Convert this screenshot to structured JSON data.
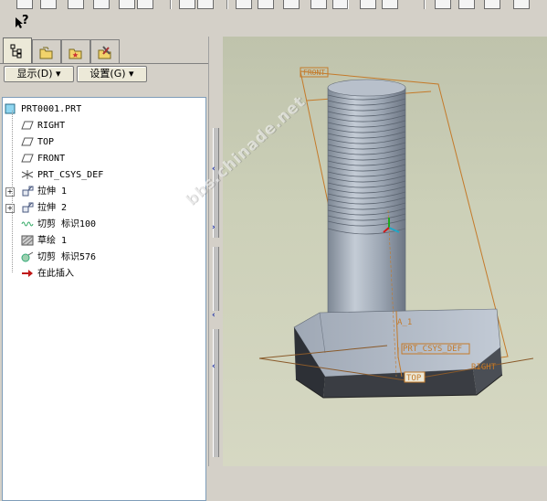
{
  "toolbar": {
    "icons": [
      "new-icon",
      "open-icon",
      "save-icon",
      "print-icon",
      "send-icon",
      "undo-icon",
      "redo-icon",
      "cut-icon",
      "copy-icon",
      "paste-icon",
      "paste-special-icon",
      "regenerate-icon",
      "find-icon",
      "select-icon",
      "saved-view-icon",
      "layers-icon",
      "display-style-icon",
      "datum-icon",
      "spin-icon"
    ],
    "whats_this_glyph": "?"
  },
  "left_panel": {
    "tabs": [
      {
        "name": "model-tree-tab",
        "icon": "model-tree-icon",
        "active": true
      },
      {
        "name": "folder-browser-tab",
        "icon": "folder-icon",
        "active": false
      },
      {
        "name": "favorites-tab",
        "icon": "favorites-icon",
        "active": false
      },
      {
        "name": "web-tab",
        "icon": "tools-icon",
        "active": false
      }
    ],
    "show_label": "显示(D)",
    "settings_label": "设置(G)"
  },
  "model_tree": {
    "items": [
      {
        "label": "PRT0001.PRT",
        "icon": "part-icon",
        "level": 0,
        "expander": ""
      },
      {
        "label": "RIGHT",
        "icon": "datum-plane-icon",
        "level": 1,
        "expander": ""
      },
      {
        "label": "TOP",
        "icon": "datum-plane-icon",
        "level": 1,
        "expander": ""
      },
      {
        "label": "FRONT",
        "icon": "datum-plane-icon",
        "level": 1,
        "expander": ""
      },
      {
        "label": "PRT_CSYS_DEF",
        "icon": "csys-icon",
        "level": 1,
        "expander": ""
      },
      {
        "label": "拉伸 1",
        "icon": "extrude-icon",
        "level": 1,
        "expander": "+"
      },
      {
        "label": "拉伸 2",
        "icon": "extrude-icon",
        "level": 1,
        "expander": "+"
      },
      {
        "label": "切剪 标识100",
        "icon": "cosmetic-thread-icon",
        "level": 1,
        "expander": ""
      },
      {
        "label": "草绘 1",
        "icon": "sketch-icon",
        "level": 1,
        "expander": ""
      },
      {
        "label": "切剪 标识576",
        "icon": "revolve-cut-icon",
        "level": 1,
        "expander": ""
      },
      {
        "label": "在此插入",
        "icon": "insert-here-arrow-icon",
        "level": 1,
        "expander": ""
      }
    ]
  },
  "viewport": {
    "datum_labels": {
      "front": "FRONT",
      "a1": "A_1",
      "csys": "PRT_CSYS_DEF",
      "right": "RIGHT",
      "top": "TOP"
    },
    "watermark": "bbs.chinade.net"
  },
  "colors": {
    "bolt_body": "#a9b2bd",
    "datum": "#c47a2a",
    "panel_bg": "#d4d0c8",
    "viewport_bg": "#ccd0b8",
    "tree_border": "#7f9db9"
  }
}
